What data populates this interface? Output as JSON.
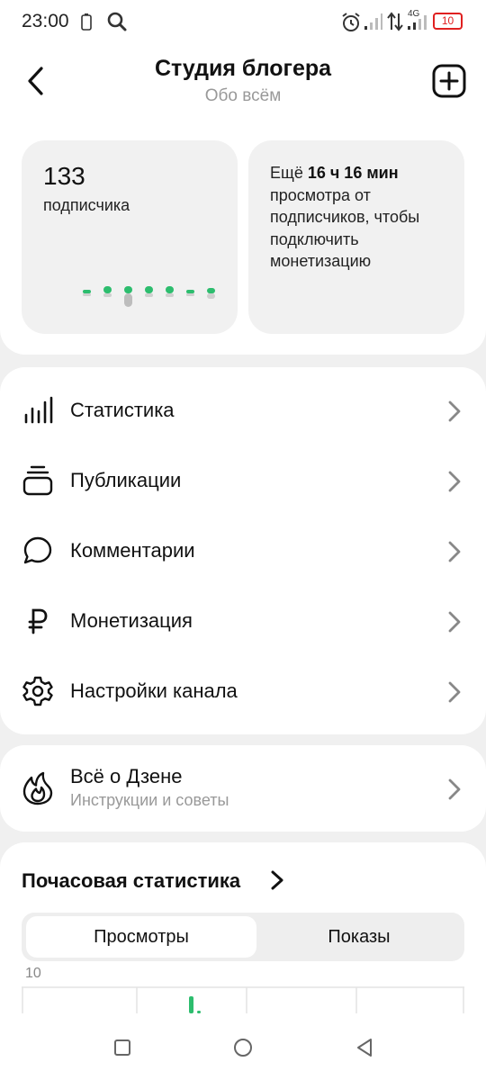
{
  "status_bar": {
    "time": "23:00",
    "network": "4G",
    "battery": "10",
    "icons": [
      "battery-outline-icon",
      "search-icon",
      "alarm-icon",
      "signal-icon",
      "data-arrows-icon",
      "signal-4g-icon",
      "battery-icon"
    ]
  },
  "header": {
    "title": "Студия блогера",
    "subtitle": "Обо всём",
    "icons": [
      "back-arrow-icon",
      "add-square-icon"
    ]
  },
  "subscribers_card": {
    "count": "133",
    "label": "подписчика",
    "sparkline_icon": "sparkline-icon"
  },
  "monetization_card": {
    "prefix": "Ещё ",
    "highlight": "16 ч 16 мин",
    "text": "просмотра от подписчиков, чтобы подключить монетизацию"
  },
  "menu": {
    "items": [
      {
        "label": "Статистика",
        "icon": "bar-chart-icon"
      },
      {
        "label": "Публикации",
        "icon": "stack-icon"
      },
      {
        "label": "Комментарии",
        "icon": "comment-icon"
      },
      {
        "label": "Монетизация",
        "icon": "ruble-icon"
      },
      {
        "label": "Настройки канала",
        "icon": "gear-icon"
      }
    ]
  },
  "zen": {
    "title": "Всё о Дзене",
    "subtitle": "Инструкции и советы",
    "icon": "flame-icon"
  },
  "hourly_stats": {
    "title": "Почасовая статистика",
    "tabs": {
      "active": "Просмотры",
      "inactive": "Показы"
    },
    "y_max_label": "10"
  },
  "nav_bar": {
    "icons": [
      "recents-square-icon",
      "home-circle-icon",
      "back-triangle-icon"
    ]
  },
  "colors": {
    "accent_green": "#2dbd6e",
    "card_bg": "#f1f1f1",
    "page_bg": "#f0f0f0",
    "battery_red": "#e02020"
  }
}
